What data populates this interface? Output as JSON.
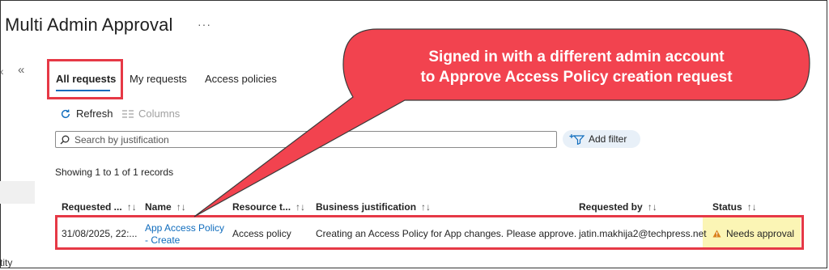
{
  "header": {
    "title": "Multi Admin Approval",
    "more": "···"
  },
  "left_nav": {
    "collapse": "«",
    "prev": "‹",
    "cut_text": "tity"
  },
  "tabs": [
    {
      "label": "All requests",
      "selected": true
    },
    {
      "label": "My requests"
    },
    {
      "label": "Access policies"
    }
  ],
  "commands": {
    "refresh": "Refresh",
    "columns": "Columns"
  },
  "search": {
    "placeholder": "Search by justification",
    "add_filter": "Add filter"
  },
  "records_text": "Showing 1 to 1 of 1 records",
  "table": {
    "sort_glyph": "↑↓",
    "columns": [
      "Requested ...",
      "Name",
      "Resource t...",
      "Business justification",
      "Requested by",
      "Status"
    ],
    "rows": [
      {
        "requested": "31/08/2025, 22:...",
        "name_line1": "App Access Policy",
        "name_line2": "- Create",
        "resource": "Access policy",
        "justification": "Creating an Access Policy for App changes. Please approve.",
        "requested_by": "jatin.makhija2@techpress.net",
        "status": "Needs approval"
      }
    ]
  },
  "callout": {
    "line1": "Signed in with a different admin account",
    "line2": "to Approve Access Policy creation request"
  },
  "colors": {
    "accent": "#0f6cbd",
    "highlight_border": "#e63946",
    "callout": "#f2434f",
    "status_bg": "#fbf5b5",
    "warning": "#d9811b"
  }
}
